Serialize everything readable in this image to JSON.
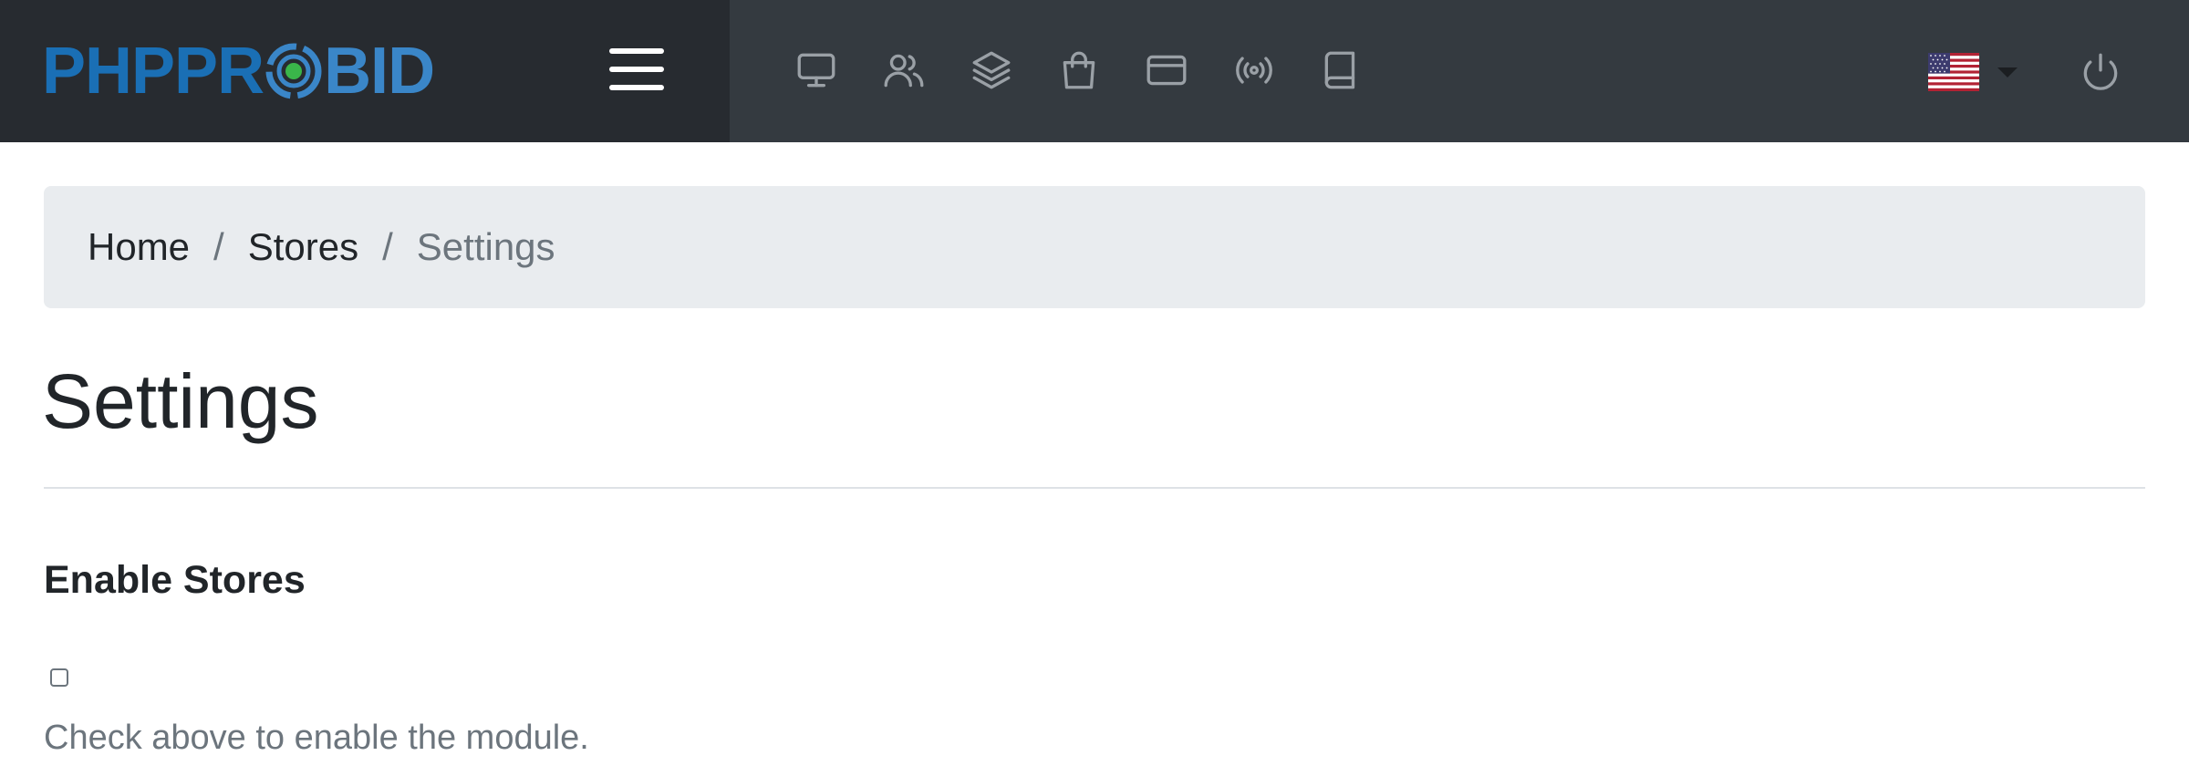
{
  "header": {
    "logo": {
      "prefix": "PHPPR",
      "suffix": "BID"
    },
    "menu_icon": "hamburger-menu-icon",
    "nav_icons": [
      "monitor-icon",
      "users-icon",
      "layers-icon",
      "shopping-bag-icon",
      "credit-card-icon",
      "broadcast-icon",
      "book-icon"
    ],
    "language_icon": "us-flag-icon",
    "logout_icon": "power-icon"
  },
  "breadcrumb": {
    "items": [
      "Home",
      "Stores"
    ],
    "active": "Settings",
    "separator": "/"
  },
  "page": {
    "title": "Settings"
  },
  "form": {
    "field_label": "Enable Stores",
    "checkbox_checked": false,
    "help_text": "Check above to enable the module."
  },
  "colors": {
    "topbar": "#343a40",
    "brand_block": "#272b30",
    "logo_blue": "#1a6fb5",
    "logo_green": "#3ab54a",
    "breadcrumb_bg": "#e9ecef",
    "muted_text": "#6c757d"
  }
}
